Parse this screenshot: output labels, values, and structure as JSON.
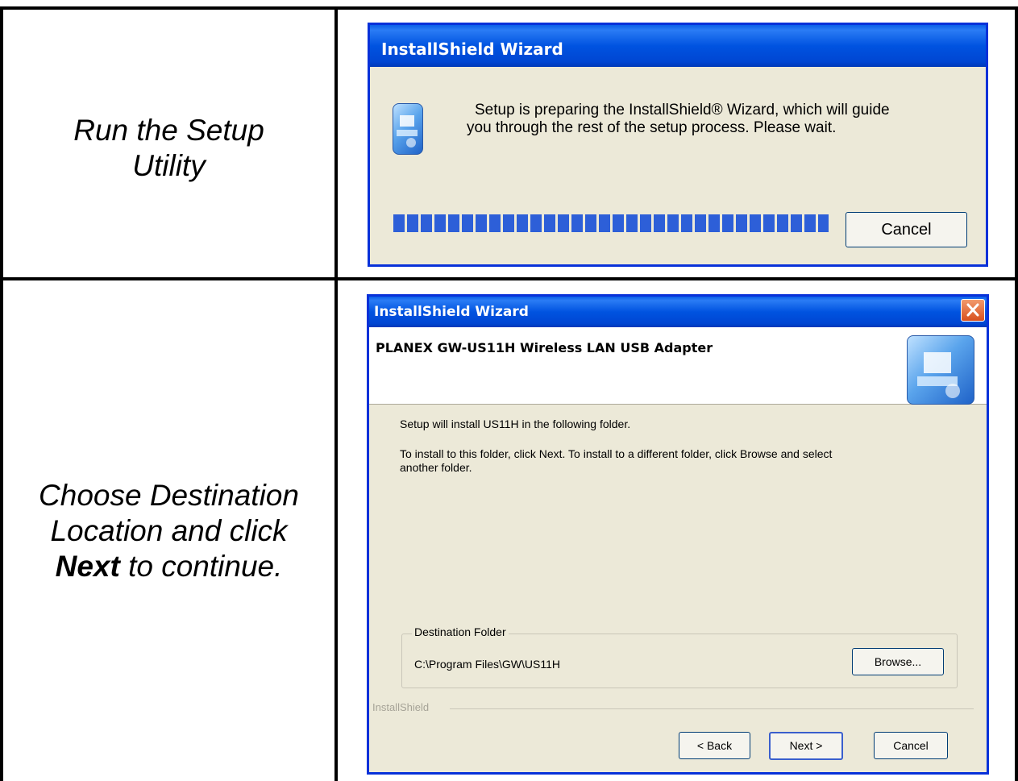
{
  "rows": [
    {
      "caption": [
        "Run the Setup",
        "Utility"
      ],
      "window": {
        "title": "InstallShield Wizard",
        "message": [
          "Setup is preparing the InstallShield® Wizard, which will guide",
          "you through the rest of the setup process. Please wait."
        ],
        "progress_percent": 100,
        "cancel_label": "Cancel"
      }
    },
    {
      "caption": {
        "line1": "Choose Destination",
        "line2": "Location and click",
        "line3_bold": "Next",
        "line3_rest": " to continue."
      },
      "window": {
        "title": "InstallShield Wizard",
        "header_title": "PLANEX GW-US11H Wireless LAN USB Adapter",
        "body_line1": "Setup will install US11H in the following folder.",
        "body_line2": "To install to this folder, click Next. To install to a different folder, click Browse and select",
        "body_line3": "another folder.",
        "group_label": "Destination Folder",
        "folder_path": "C:\\Program Files\\GW\\US11H",
        "browse_label": "Browse...",
        "brand_label": "InstallShield",
        "back_label": "< Back",
        "next_label": "Next >",
        "cancel_label": "Cancel"
      }
    }
  ],
  "icons": {
    "setup": "setup-computer-icon",
    "close": "close-icon"
  },
  "colors": {
    "title_blue": "#0053e0",
    "dialog_bg": "#ece9d8",
    "progress_blue": "#2d5fd8",
    "close_red": "#e45a2c"
  }
}
